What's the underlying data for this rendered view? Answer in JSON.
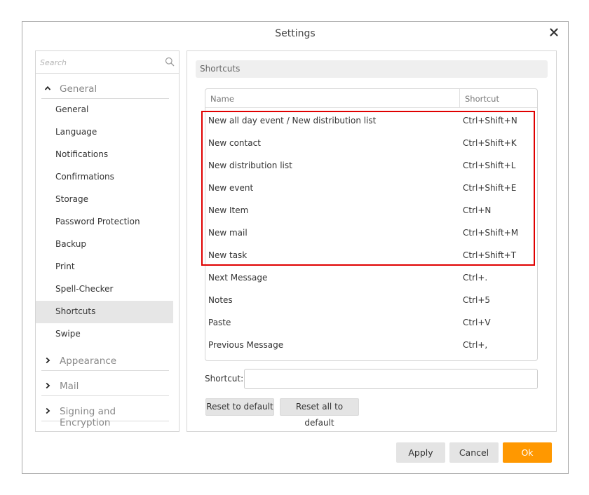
{
  "window": {
    "title": "Settings"
  },
  "search": {
    "placeholder": "Search"
  },
  "nav": {
    "groups": [
      {
        "label": "General",
        "expanded": true
      },
      {
        "label": "Appearance",
        "expanded": false
      },
      {
        "label": "Mail",
        "expanded": false
      },
      {
        "label": "Signing and Encryption",
        "expanded": false
      }
    ],
    "items": [
      "General",
      "Language",
      "Notifications",
      "Confirmations",
      "Storage",
      "Password Protection",
      "Backup",
      "Print",
      "Spell-Checker",
      "Shortcuts",
      "Swipe"
    ],
    "active": "Shortcuts"
  },
  "section": {
    "title": "Shortcuts"
  },
  "table": {
    "headers": {
      "name": "Name",
      "shortcut": "Shortcut"
    },
    "rows": [
      {
        "name": "New all day event / New distribution list",
        "shortcut": "Ctrl+Shift+N"
      },
      {
        "name": "New contact",
        "shortcut": "Ctrl+Shift+K"
      },
      {
        "name": "New distribution list",
        "shortcut": "Ctrl+Shift+L"
      },
      {
        "name": "New event",
        "shortcut": "Ctrl+Shift+E"
      },
      {
        "name": "New Item",
        "shortcut": "Ctrl+N"
      },
      {
        "name": "New mail",
        "shortcut": "Ctrl+Shift+M"
      },
      {
        "name": "New task",
        "shortcut": "Ctrl+Shift+T"
      },
      {
        "name": "Next Message",
        "shortcut": "Ctrl+."
      },
      {
        "name": "Notes",
        "shortcut": "Ctrl+5"
      },
      {
        "name": "Paste",
        "shortcut": "Ctrl+V"
      },
      {
        "name": "Previous Message",
        "shortcut": "Ctrl+,"
      }
    ]
  },
  "shortcut_field": {
    "label": "Shortcut:",
    "value": ""
  },
  "buttons": {
    "reset": "Reset to default",
    "reset_all": "Reset all to default",
    "apply": "Apply",
    "cancel": "Cancel",
    "ok": "Ok"
  },
  "colors": {
    "accent": "#ff9800",
    "highlight_border": "#e00000",
    "active_item": "#e6e6e6"
  },
  "icons": {
    "close": "close-icon",
    "search": "search-icon",
    "expanded": "chevron-up-icon",
    "collapsed": "chevron-right-icon"
  }
}
